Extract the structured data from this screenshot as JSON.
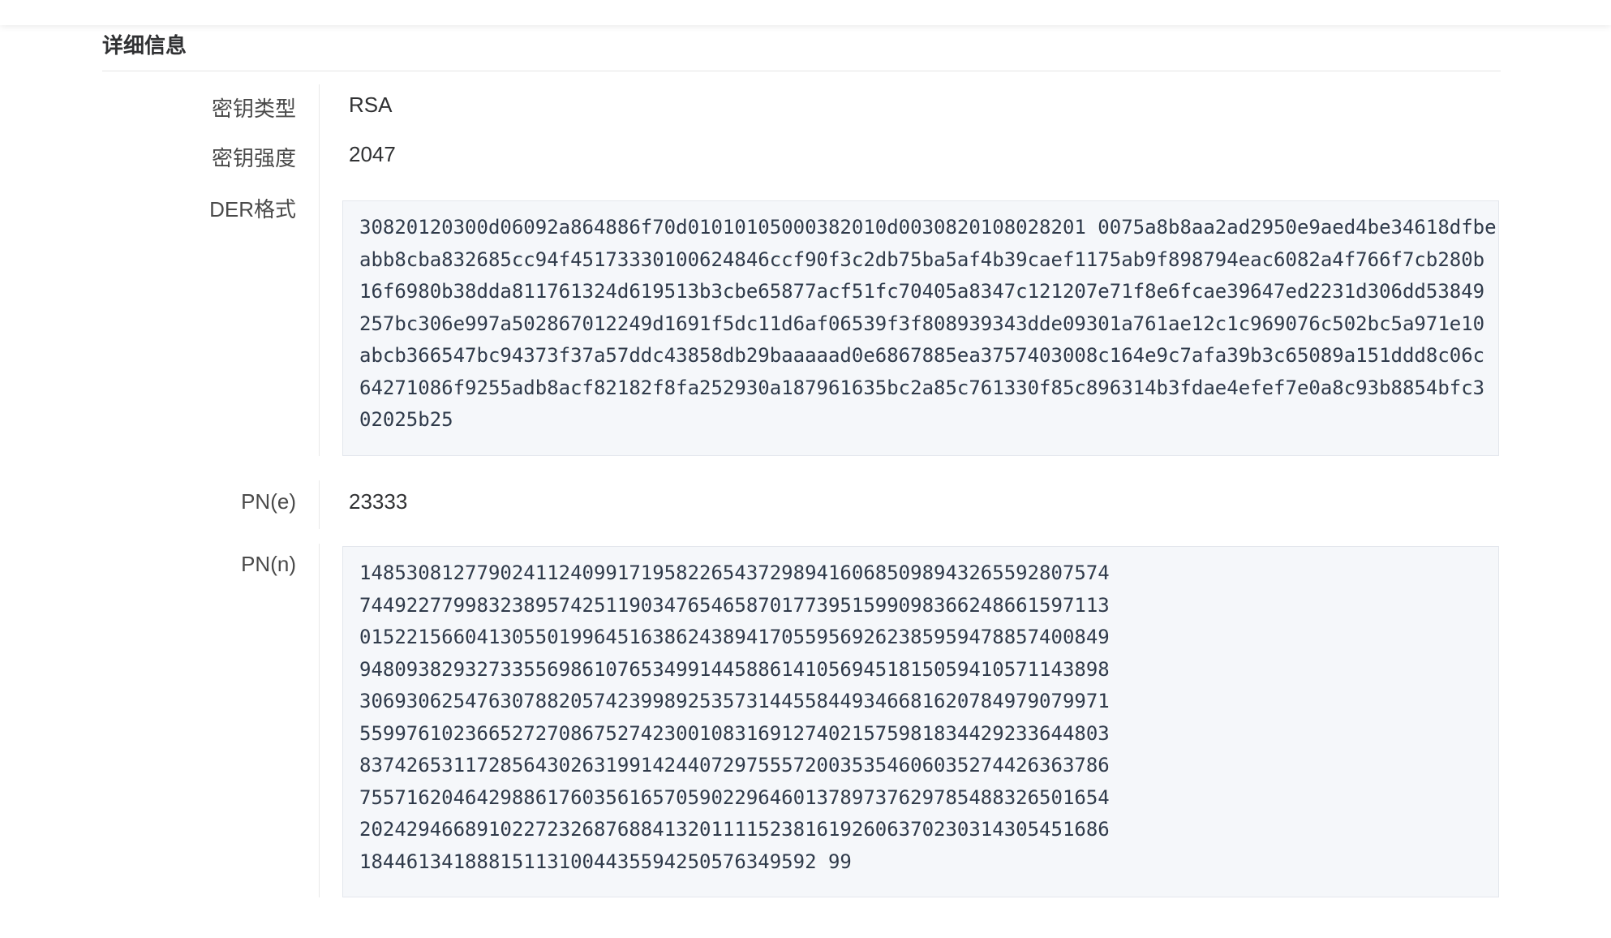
{
  "section_title": "详细信息",
  "fields": {
    "key_type": {
      "label": "密钥类型",
      "value": "RSA"
    },
    "key_strength": {
      "label": "密钥强度",
      "value": "2047"
    },
    "der": {
      "label": "DER格式",
      "lines": [
        "30820120300d06092a864886f70d01010105000382010d0030820108028201 0075a8b8aa2ad2950e9aed4be34618dfbe",
        "abb8cba832685cc94f45173330100624846ccf90f3c2db75ba5af4b39caef1175ab9f898794eac6082a4f766f7cb280b",
        "16f6980b38dda811761324d619513b3cbe65877acf51fc70405a8347c121207e71f8e6fcae39647ed2231d306dd53849",
        "257bc306e997a502867012249d1691f5dc11d6af06539f3f808939343dde09301a761ae12c1c969076c502bc5a971e10",
        "abcb366547bc94373f37a57ddc43858db29baaaaad0e6867885ea3757403008c164e9c7afa39b3c65089a151ddd8c06c",
        "64271086f9255adb8acf82182f8fa252930a187961635bc2a85c761330f85c896314b3fdae4efef7e0a8c93b8854bfc3",
        "02025b25"
      ]
    },
    "pn_e": {
      "label": "PN(e)",
      "value": "23333"
    },
    "pn_n": {
      "label": "PN(n)",
      "lines": [
        "1485308127790241124099171958226543729894160685098943265592807574",
        "7449227799832389574251190347654658701773951599098366248661597113",
        "0152215660413055019964516386243894170559569262385959478857400849",
        "9480938293273355698610765349914458861410569451815059410571143898",
        "3069306254763078820574239989253573144558449346681620784979079971",
        "5599761023665272708675274230010831691274021575981834429233644803",
        "8374265311728564302631991424407297555720035354606035274426363786",
        "7557162046429886176035616570590229646013789737629785488326501654",
        "2024294668910227232687688413201111523816192606370230314305451686",
        "184461341888151131004435594250576349592 99"
      ]
    }
  }
}
